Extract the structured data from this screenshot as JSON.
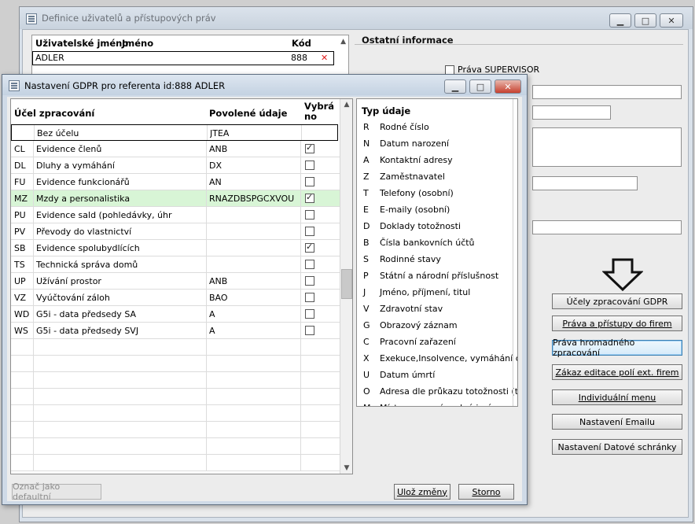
{
  "bg_window": {
    "title": "Definice uživatelů a přístupových práv",
    "user_table": {
      "headers": {
        "username": "Uživatelské jméno",
        "name": "Jméno",
        "code": "Kód"
      },
      "row": {
        "username": "ADLER",
        "name": "",
        "code": "888"
      }
    },
    "other_info": {
      "title": "Ostatní informace",
      "supervisor_label": "Práva SUPERVISOR"
    },
    "buttons": [
      "Účely zpracování GDPR",
      "Práva a přístupy do firem",
      "Práva hromadného zpracování",
      "Zákaz editace polí ext. firem",
      "Individuální menu",
      "Nastavení Emailu",
      "Nastavení Datové schránky"
    ]
  },
  "gdpr_dialog": {
    "title": "Nastavení GDPR pro referenta id:888 ADLER",
    "table": {
      "headers": {
        "purpose": "Účel zpracování",
        "allowed": "Povolené údaje",
        "selected_l1": "Vybrá",
        "selected_l2": "no"
      },
      "rows": [
        {
          "code": "",
          "name": "Bez účelu",
          "allowed": "JTEA",
          "checked": null
        },
        {
          "code": "CL",
          "name": "Evidence členů",
          "allowed": "ANB",
          "checked": true
        },
        {
          "code": "DL",
          "name": "Dluhy a vymáhání",
          "allowed": "DX",
          "checked": false
        },
        {
          "code": "FU",
          "name": "Evidence funkcionářů",
          "allowed": "AN",
          "checked": false
        },
        {
          "code": "MZ",
          "name": "Mzdy a personalistika",
          "allowed": "RNAZDBSPGCXVOU",
          "checked": true
        },
        {
          "code": "PU",
          "name": "Evidence sald (pohledávky, úhr",
          "allowed": "",
          "checked": false
        },
        {
          "code": "PV",
          "name": "Převody do vlastnictví",
          "allowed": "",
          "checked": false
        },
        {
          "code": "SB",
          "name": "Evidence spolubydlících",
          "allowed": "",
          "checked": true
        },
        {
          "code": "TS",
          "name": "Technická správa domů",
          "allowed": "",
          "checked": false
        },
        {
          "code": "UP",
          "name": "Užívání prostor",
          "allowed": "ANB",
          "checked": false
        },
        {
          "code": "VZ",
          "name": "Vyúčtování záloh",
          "allowed": "BAO",
          "checked": false
        },
        {
          "code": "WD",
          "name": "G5i - data předsedy SA",
          "allowed": "A",
          "checked": false
        },
        {
          "code": "WS",
          "name": "G5i - data předsedy SVJ",
          "allowed": "A",
          "checked": false
        }
      ]
    },
    "types": {
      "header": "Typ údaje",
      "items": [
        {
          "code": "R",
          "label": "Rodné číslo"
        },
        {
          "code": "N",
          "label": "Datum narození"
        },
        {
          "code": "A",
          "label": "Kontaktní adresy"
        },
        {
          "code": "Z",
          "label": "Zaměstnavatel"
        },
        {
          "code": "T",
          "label": "Telefony (osobní)"
        },
        {
          "code": "E",
          "label": "E-maily (osobní)"
        },
        {
          "code": "D",
          "label": "Doklady totožnosti"
        },
        {
          "code": "B",
          "label": "Čísla bankovních účtů"
        },
        {
          "code": "S",
          "label": "Rodinné stavy"
        },
        {
          "code": "P",
          "label": "Státní a národní příslušnost"
        },
        {
          "code": "J",
          "label": "Jméno, příjmení, titul"
        },
        {
          "code": "V",
          "label": "Zdravotní stav"
        },
        {
          "code": "G",
          "label": "Obrazový záznam"
        },
        {
          "code": "C",
          "label": "Pracovní zařazení"
        },
        {
          "code": "X",
          "label": "Exekuce,Insolvence, vymáhání dlu"
        },
        {
          "code": "U",
          "label": "Datum úmrtí"
        },
        {
          "code": "O",
          "label": "Adresa dle průkazu totožnosti (trvalá"
        },
        {
          "code": "M",
          "label": "Místo narození, rodné jméno"
        }
      ]
    },
    "buttons": {
      "default": "Označ jako defaultní",
      "save": "Ulož změny",
      "cancel": "Storno"
    }
  }
}
